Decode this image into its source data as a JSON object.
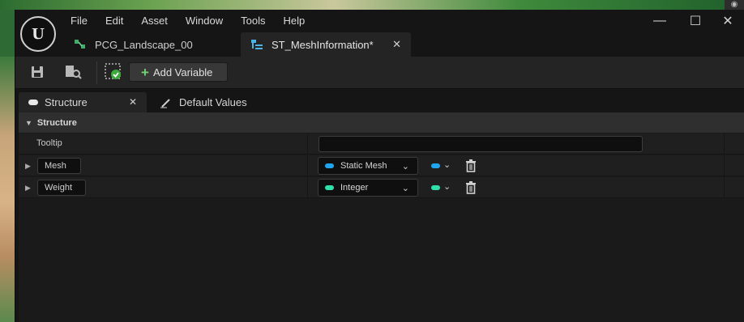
{
  "menu": [
    "File",
    "Edit",
    "Asset",
    "Window",
    "Tools",
    "Help"
  ],
  "doc_tabs": [
    {
      "label": "PCG_Landscape_00",
      "icon": "pcg-graph-icon"
    },
    {
      "label": "ST_MeshInformation*",
      "icon": "struct-icon",
      "close": "✕"
    }
  ],
  "window_controls": {
    "minimize": "—",
    "maximize": "☐",
    "close": "✕"
  },
  "toolbar": {
    "add_variable_label": "Add Variable"
  },
  "panel_tabs": [
    {
      "label": "Structure",
      "close": "✕"
    },
    {
      "label": "Default Values"
    }
  ],
  "section": {
    "title": "Structure"
  },
  "tooltip_row": {
    "label": "Tooltip",
    "value": ""
  },
  "variables": [
    {
      "name": "Mesh",
      "type": "Static Mesh",
      "type_color": "#1ea7f0"
    },
    {
      "name": "Weight",
      "type": "Integer",
      "type_color": "#2fe0a8"
    }
  ]
}
